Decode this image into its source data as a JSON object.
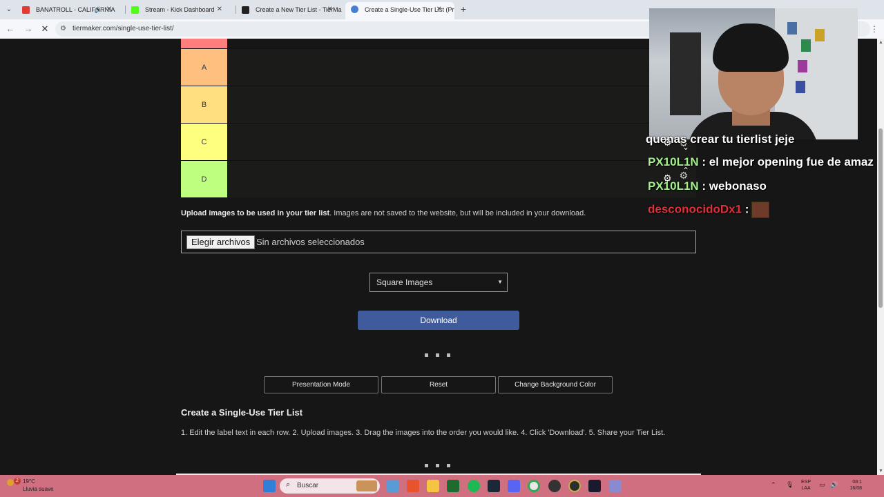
{
  "browser": {
    "tabs": [
      {
        "title": "BANATROLL - CALIFORNIA",
        "favicon_color": "#e53935",
        "audio": true
      },
      {
        "title": "Stream - Kick Dashboard",
        "favicon_color": "#53fc18"
      },
      {
        "title": "Create a New Tier List - TierMa",
        "favicon_color": "#222222"
      },
      {
        "title": "Create a Single-Use Tier List (Pr",
        "favicon_color": "#4a7fd0",
        "active": true
      }
    ],
    "url": "tiermaker.com/single-use-tier-list/"
  },
  "tiers": [
    {
      "label": "A",
      "color": "#ffbf7f"
    },
    {
      "label": "B",
      "color": "#ffdf7f"
    },
    {
      "label": "C",
      "color": "#ffff7f"
    },
    {
      "label": "D",
      "color": "#bfff7f"
    }
  ],
  "upload": {
    "bold": "Upload images to be used in your tier list",
    "rest": ". Images are not saved to the website, but will be included in your download.",
    "choose_label": "Elegir archivos",
    "status": "Sin archivos seleccionados"
  },
  "image_shape_select": {
    "value": "Square Images"
  },
  "download_label": "Download",
  "options": {
    "presentation": "Presentation Mode",
    "reset": "Reset",
    "background": "Change Background Color"
  },
  "section_title": "Create a Single-Use Tier List",
  "instructions": "1. Edit the label text in each row. 2. Upload images. 3. Drag the images into the order you would like. 4. Click 'Download'. 5. Share your Tier List.",
  "chat": {
    "line1_text": "quenas crear tu tierlist jeje",
    "line2_user": "PX10L1N",
    "line2_text": " : el mejor opening fue de amaz",
    "line3_user": "PX10L1N",
    "line3_text": " : webonaso",
    "line4_user": "desconocidoDx1",
    "line4_sep": " :"
  },
  "taskbar": {
    "weather_badge": "2",
    "temperature": "19°C",
    "weather": "Lluvia suave",
    "search_placeholder": "Buscar",
    "lang_top": "ESP",
    "lang_bottom": "LAA",
    "time": "08:1",
    "date": "16/08"
  }
}
